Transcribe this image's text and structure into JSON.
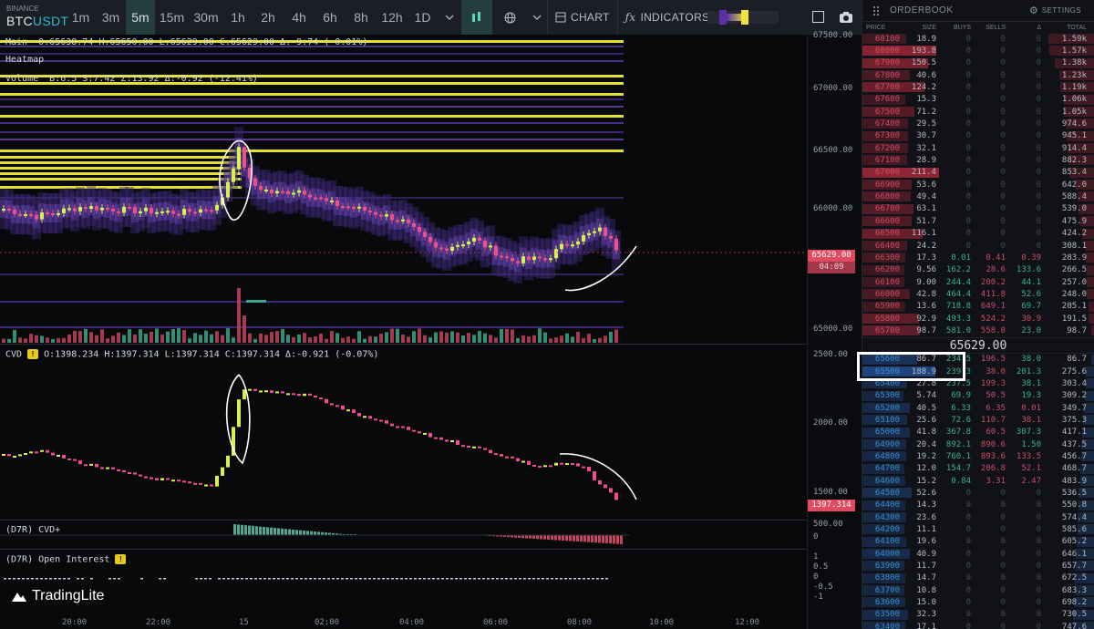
{
  "toolbar": {
    "exchange": "BINANCE",
    "base": "BTC",
    "quote": "USDT",
    "timeframes": [
      "1m",
      "3m",
      "5m",
      "15m",
      "30m",
      "1h",
      "2h",
      "4h",
      "6h",
      "8h",
      "12h",
      "1D"
    ],
    "active_timeframe": "5m",
    "chart_label": "CHART",
    "indicators_label": "INDICATORS",
    "accent": "#243e3e"
  },
  "legend": {
    "main_name": "Main",
    "main_values": "O:65638.74 H:65650.00 L:65629.00 C:65629.00 Δ:-9.74 (-0.01%)",
    "heatmap": "Heatmap",
    "volume_name": "Volume",
    "volume_values": "B:6.5 S:7.42 Σ:13.92 Δ:-0.92 (-12.41%)",
    "cvd_name": "CVD",
    "cvd_values": "O:1398.234 H:1397.314 L:1397.314 C:1397.314 Δ:-0.921 (-0.07%)",
    "cvdplus": "(D7R) CVD+",
    "oi": "(D7R) Open Interest",
    "brand": "TradingLite"
  },
  "price_axis": {
    "main": [
      "67500.00",
      "67000.00",
      "66500.00",
      "66000.00",
      "65500.00",
      "65000.00"
    ],
    "cvd": [
      "2500.00",
      "2000.00",
      "1500.00"
    ],
    "cvdplus": [
      "500.00",
      "0"
    ],
    "oi": [
      "1",
      "0.5",
      "0",
      "-0.5",
      "-1"
    ],
    "price_tag": "65629.00",
    "countdown": "04:09",
    "cvd_tag": "1397.314"
  },
  "time_axis": [
    "20:00",
    "22:00",
    "15",
    "02:00",
    "04:00",
    "06:00",
    "08:00",
    "10:00",
    "12:00"
  ],
  "orderbook": {
    "title": "ORDERBOOK",
    "settings": "SETTINGS",
    "columns": [
      "PRICE",
      "SIZE",
      "BUYS",
      "SELLS",
      "Δ",
      "TOTAL"
    ],
    "mid": "65629.00",
    "asks": [
      [
        "68100",
        "18.9",
        "0",
        "0",
        "0",
        "1.59k"
      ],
      [
        "68000",
        "193.8",
        "0",
        "0",
        "0",
        "1.57k"
      ],
      [
        "67900",
        "150.5",
        "0",
        "0",
        "0",
        "1.38k"
      ],
      [
        "67800",
        "40.6",
        "0",
        "0",
        "0",
        "1.23k"
      ],
      [
        "67700",
        "124.2",
        "0",
        "0",
        "0",
        "1.19k"
      ],
      [
        "67600",
        "15.3",
        "0",
        "0",
        "0",
        "1.06k"
      ],
      [
        "67500",
        "71.2",
        "0",
        "0",
        "0",
        "1.05k"
      ],
      [
        "67400",
        "29.5",
        "0",
        "0",
        "0",
        "974.6"
      ],
      [
        "67300",
        "30.7",
        "0",
        "0",
        "0",
        "945.1"
      ],
      [
        "67200",
        "32.1",
        "0",
        "0",
        "0",
        "914.4"
      ],
      [
        "67100",
        "28.9",
        "0",
        "0",
        "0",
        "882.3"
      ],
      [
        "67000",
        "211.4",
        "0",
        "0",
        "0",
        "853.4"
      ],
      [
        "66900",
        "53.6",
        "0",
        "0",
        "0",
        "642.0"
      ],
      [
        "66800",
        "49.4",
        "0",
        "0",
        "0",
        "588.4"
      ],
      [
        "66700",
        "63.1",
        "0",
        "0",
        "0",
        "539.0"
      ],
      [
        "66600",
        "51.7",
        "0",
        "0",
        "0",
        "475.9"
      ],
      [
        "66500",
        "116.1",
        "0",
        "0",
        "0",
        "424.2"
      ],
      [
        "66400",
        "24.2",
        "0",
        "0",
        "0",
        "308.1"
      ],
      [
        "66300",
        "17.3",
        "0.01",
        "0.41",
        "0.39",
        "283.9"
      ],
      [
        "66200",
        "9.56",
        "162.2",
        "28.6",
        "133.6",
        "266.5"
      ],
      [
        "66100",
        "9.00",
        "244.4",
        "200.2",
        "44.1",
        "257.0"
      ],
      [
        "66000",
        "42.8",
        "464.4",
        "411.8",
        "52.6",
        "248.0"
      ],
      [
        "65900",
        "13.6",
        "718.8",
        "649.1",
        "69.7",
        "205.1"
      ],
      [
        "65800",
        "92.9",
        "493.3",
        "524.2",
        "30.9",
        "191.5"
      ],
      [
        "65700",
        "98.7",
        "581.0",
        "558.0",
        "23.0",
        "98.7"
      ]
    ],
    "bids": [
      [
        "65600",
        "86.7",
        "234.5",
        "196.5",
        "38.0",
        "86.7"
      ],
      [
        "65500",
        "188.9",
        "239.3",
        "38.0",
        "201.3",
        "275.6"
      ],
      [
        "65400",
        "27.8",
        "237.5",
        "199.3",
        "38.1",
        "303.4"
      ],
      [
        "65300",
        "5.74",
        "69.9",
        "50.5",
        "19.3",
        "309.2"
      ],
      [
        "65200",
        "40.5",
        "6.33",
        "6.35",
        "0.01",
        "349.7"
      ],
      [
        "65100",
        "25.6",
        "72.6",
        "110.7",
        "38.1",
        "375.3"
      ],
      [
        "65000",
        "41.8",
        "367.8",
        "60.5",
        "307.3",
        "417.1"
      ],
      [
        "64900",
        "20.4",
        "892.1",
        "890.6",
        "1.50",
        "437.5"
      ],
      [
        "64800",
        "19.2",
        "760.1",
        "893.6",
        "133.5",
        "456.7"
      ],
      [
        "64700",
        "12.0",
        "154.7",
        "206.8",
        "52.1",
        "468.7"
      ],
      [
        "64600",
        "15.2",
        "0.84",
        "3.31",
        "2.47",
        "483.9"
      ],
      [
        "64500",
        "52.6",
        "0",
        "0",
        "0",
        "536.5"
      ],
      [
        "64400",
        "14.3",
        "0",
        "0",
        "0",
        "550.8"
      ],
      [
        "64300",
        "23.6",
        "0",
        "0",
        "0",
        "574.4"
      ],
      [
        "64200",
        "11.1",
        "0",
        "0",
        "0",
        "585.6"
      ],
      [
        "64100",
        "19.6",
        "0",
        "0",
        "0",
        "605.2"
      ],
      [
        "64000",
        "40.9",
        "0",
        "0",
        "0",
        "646.1"
      ],
      [
        "63900",
        "11.7",
        "0",
        "0",
        "0",
        "657.7"
      ],
      [
        "63800",
        "14.7",
        "0",
        "0",
        "0",
        "672.5"
      ],
      [
        "63700",
        "10.8",
        "0",
        "0",
        "0",
        "683.3"
      ],
      [
        "63600",
        "15.0",
        "0",
        "0",
        "0",
        "698.2"
      ],
      [
        "63500",
        "32.3",
        "0",
        "0",
        "0",
        "730.5"
      ],
      [
        "63400",
        "17.1",
        "0",
        "0",
        "0",
        "747.6"
      ]
    ]
  }
}
